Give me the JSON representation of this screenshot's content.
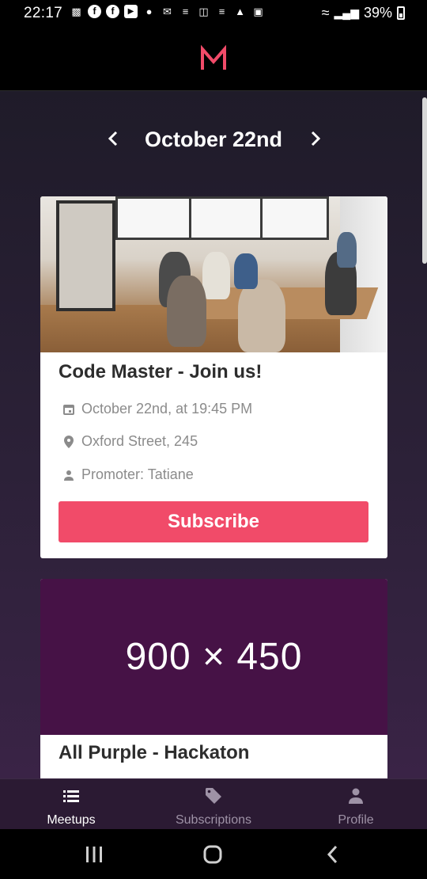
{
  "status_bar": {
    "time": "22:17",
    "battery": "39%"
  },
  "app": {
    "logo_letter": "M",
    "accent_color": "#f14b69"
  },
  "date_nav": {
    "current_date": "October 22nd",
    "prev_icon": "chevron-left-icon",
    "next_icon": "chevron-right-icon"
  },
  "meetups": [
    {
      "title": "Code Master - Join us!",
      "datetime": "October 22nd, at 19:45 PM",
      "location": "Oxford Street, 245",
      "promoter": "Promoter: Tatiane",
      "subscribe_label": "Subscribe"
    },
    {
      "image_placeholder": "900 × 450",
      "title": "All Purple - Hackaton"
    }
  ],
  "tabs": [
    {
      "label": "Meetups",
      "icon": "list-icon",
      "active": true
    },
    {
      "label": "Subscriptions",
      "icon": "tag-icon",
      "active": false
    },
    {
      "label": "Profile",
      "icon": "person-icon",
      "active": false
    }
  ]
}
